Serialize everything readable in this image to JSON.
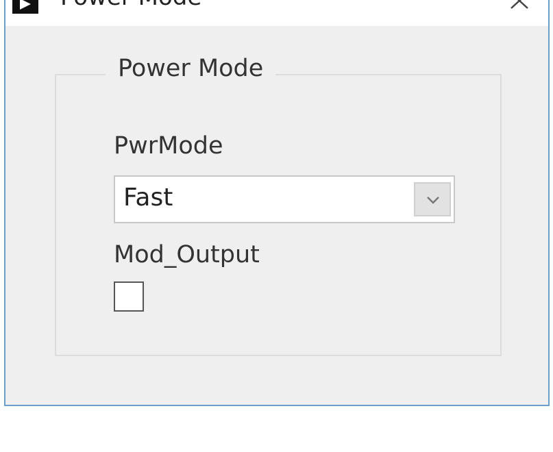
{
  "window": {
    "title": "Power Mode",
    "close_label": "×"
  },
  "group": {
    "legend": "Power Mode"
  },
  "fields": {
    "pwrmode_label": "PwrMode",
    "pwrmode_value": "Fast",
    "mod_output_label": "Mod_Output",
    "mod_output_checked": false
  },
  "colors": {
    "window_border": "#6a9fd0",
    "window_bg": "#efefef",
    "titlebar_bg": "#ffffff"
  }
}
